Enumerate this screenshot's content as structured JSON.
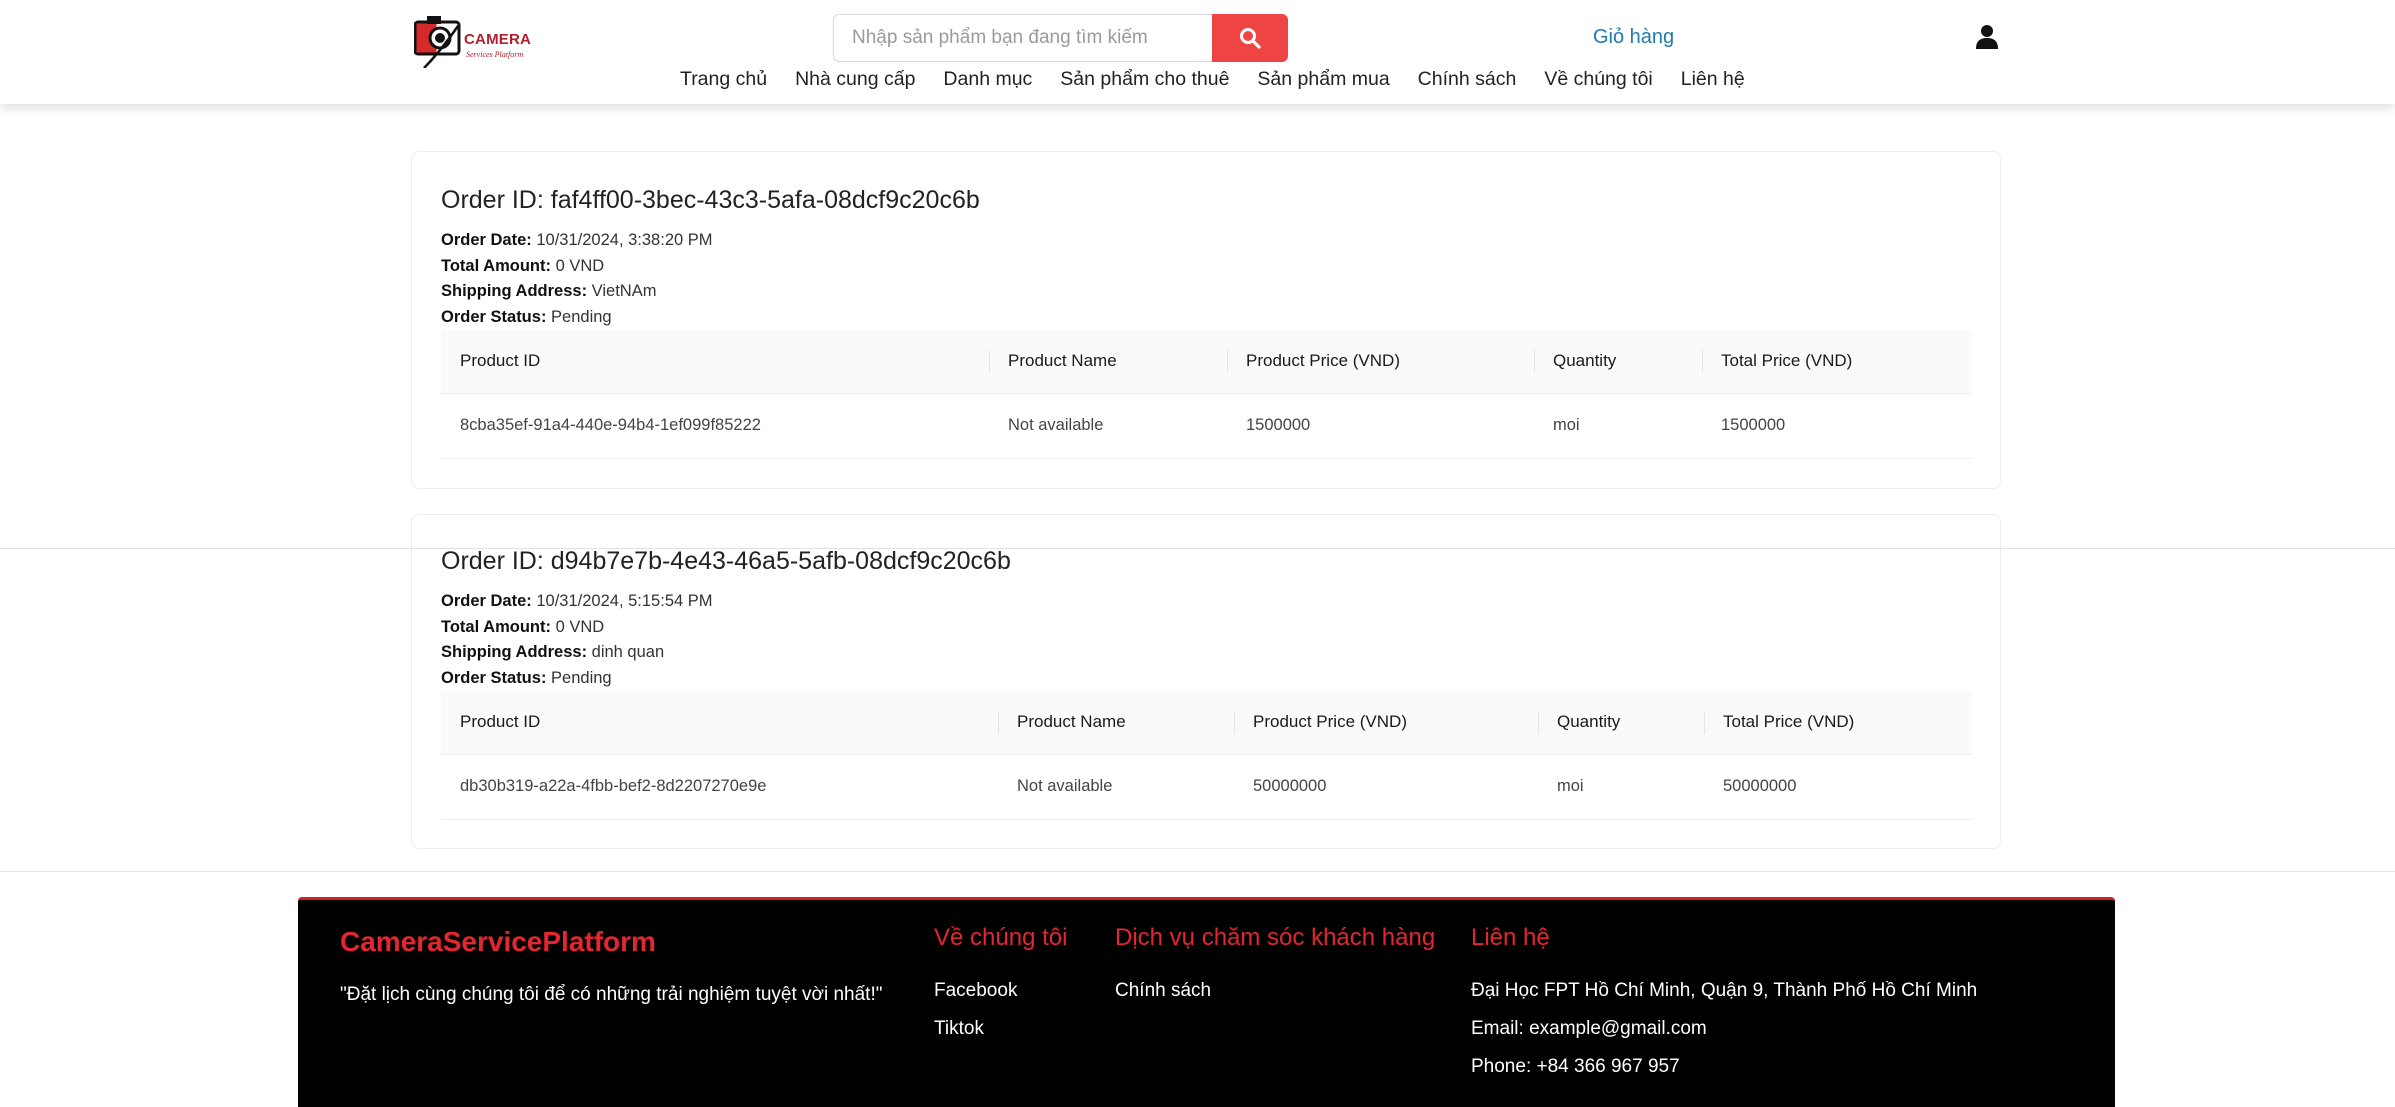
{
  "header": {
    "logo": {
      "title": "CAMERA",
      "subtitle": "Services Platform"
    },
    "search": {
      "placeholder": "Nhập sản phẩm bạn đang tìm kiếm",
      "value": ""
    },
    "cart_label": "Giỏ hàng",
    "nav": [
      "Trang chủ",
      "Nhà cung cấp",
      "Danh mục",
      "Sản phẩm cho thuê",
      "Sản phẩm mua",
      "Chính sách",
      "Về chúng tôi",
      "Liên hệ"
    ]
  },
  "labels": {
    "order_id": "Order ID:",
    "order_date": "Order Date:",
    "total_amount": "Total Amount:",
    "shipping_address": "Shipping Address:",
    "order_status": "Order Status:"
  },
  "table_headers": [
    "Product ID",
    "Product Name",
    "Product Price (VND)",
    "Quantity",
    "Total Price (VND)"
  ],
  "orders": [
    {
      "id": "faf4ff00-3bec-43c3-5afa-08dcf9c20c6b",
      "date": "10/31/2024, 3:38:20 PM",
      "total": "0 VND",
      "address": "VietNAm",
      "status": "Pending",
      "rows": [
        [
          "8cba35ef-91a4-440e-94b4-1ef099f85222",
          "Not available",
          "1500000",
          "moi",
          "1500000"
        ]
      ]
    },
    {
      "id": "d94b7e7b-4e43-46a5-5afb-08dcf9c20c6b",
      "date": "10/31/2024, 5:15:54 PM",
      "total": "0 VND",
      "address": "dinh quan",
      "status": "Pending",
      "rows": [
        [
          "db30b319-a22a-4fbb-bef2-8d2207270e9e",
          "Not available",
          "50000000",
          "moi",
          "50000000"
        ]
      ]
    }
  ],
  "footer": {
    "brand": "CameraServicePlatform",
    "quote": "\"Đặt lịch cùng chúng tôi để có những trải nghiệm tuyệt vời nhất!\"",
    "about": {
      "heading": "Về chúng tôi",
      "links": [
        "Facebook",
        "Tiktok"
      ]
    },
    "care": {
      "heading": "Dịch vụ chăm sóc khách hàng",
      "links": [
        "Chính sách"
      ]
    },
    "contact": {
      "heading": "Liên hệ",
      "address": "Đại Học FPT Hồ Chí Minh, Quận 9, Thành Phố Hồ Chí Minh",
      "email": "Email: example@gmail.com",
      "phone": "Phone: +84 366 967 957"
    }
  },
  "colors": {
    "accent_red": "#ee4444",
    "brand_red": "#e3262f",
    "link_blue": "#1f7bb0",
    "footer_bg": "#000000"
  }
}
